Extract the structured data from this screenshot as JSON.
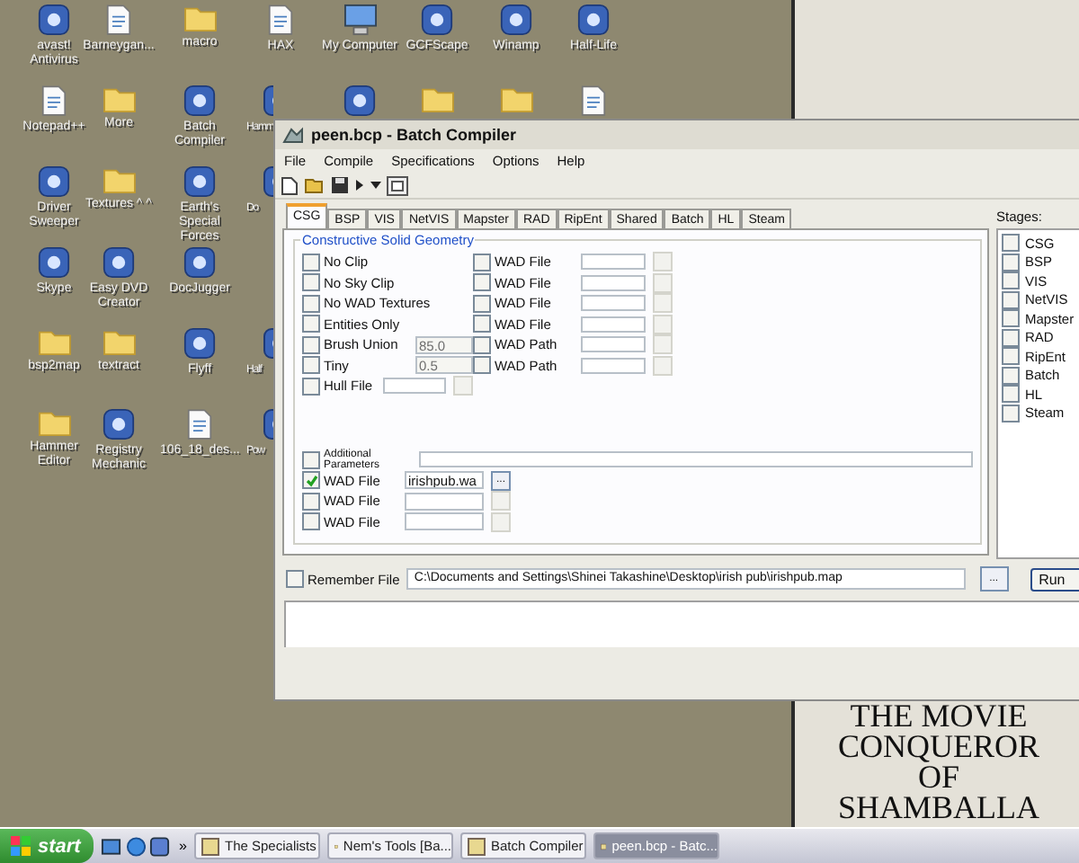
{
  "desktop": {
    "icon_rows": [
      [
        {
          "label": "avast! Antivirus",
          "kind": "app"
        },
        {
          "label": "Barneygan...",
          "kind": "document"
        },
        {
          "label": "macro",
          "kind": "folder"
        },
        {
          "label": "HAX",
          "kind": "document"
        },
        {
          "label": "My Computer",
          "kind": "computer"
        },
        {
          "label": "GCFScape",
          "kind": "app"
        },
        {
          "label": "Winamp",
          "kind": "app"
        },
        {
          "label": "Half-Life",
          "kind": "app"
        }
      ],
      [
        {
          "label": "Notepad++",
          "kind": "document"
        },
        {
          "label": "More",
          "kind": "folder"
        },
        {
          "label": "Batch Compiler",
          "kind": "app"
        },
        {
          "label": "Hamm",
          "kind": "app"
        },
        {
          "kind": "app"
        },
        {
          "kind": "folder"
        },
        {
          "kind": "folder"
        },
        {
          "kind": "document"
        }
      ],
      [
        {
          "label": "Driver Sweeper",
          "kind": "app"
        },
        {
          "label": "Textures ^ ^",
          "kind": "folder"
        },
        {
          "label": "Earth's Special Forces",
          "kind": "app"
        },
        {
          "label": "Do",
          "kind": "app"
        }
      ],
      [
        {
          "label": "Skype",
          "kind": "app"
        },
        {
          "label": "Easy DVD Creator",
          "kind": "app"
        },
        {
          "label": "DocJugger",
          "kind": "app"
        }
      ],
      [
        {
          "label": "bsp2map",
          "kind": "folder"
        },
        {
          "label": "textract",
          "kind": "folder"
        },
        {
          "label": "Flyff",
          "kind": "app"
        },
        {
          "label": "Half",
          "kind": "app"
        }
      ],
      [
        {
          "label": "Hammer Editor",
          "kind": "folder"
        },
        {
          "label": "Registry Mechanic",
          "kind": "app"
        },
        {
          "label": "106_18_des...",
          "kind": "document"
        },
        {
          "label": "Pow",
          "kind": "app"
        }
      ]
    ],
    "wallpaper_caption": [
      "THE MOVIE",
      "CONQUEROR",
      "OF",
      "SHAMBALLA"
    ]
  },
  "window": {
    "title": "peen.bcp - Batch Compiler",
    "menu": [
      "File",
      "Compile",
      "Specifications",
      "Options",
      "Help"
    ],
    "tabs": [
      {
        "label": "CSG",
        "selected": true
      },
      {
        "label": "BSP",
        "selected": false
      },
      {
        "label": "VIS",
        "selected": false
      },
      {
        "label": "NetVIS",
        "selected": false
      },
      {
        "label": "Mapster",
        "selected": false
      },
      {
        "label": "RAD",
        "selected": false
      },
      {
        "label": "RipEnt",
        "selected": false
      },
      {
        "label": "Shared",
        "selected": false
      },
      {
        "label": "Batch",
        "selected": false
      },
      {
        "label": "HL",
        "selected": false
      },
      {
        "label": "Steam",
        "selected": false
      }
    ],
    "csg": {
      "title": "Constructive Solid Geometry",
      "options": [
        {
          "label": "No Clip",
          "checked": false,
          "kind": "plain"
        },
        {
          "label": "No Sky Clip",
          "checked": false,
          "kind": "plain"
        },
        {
          "label": "No WAD Textures",
          "checked": false,
          "kind": "plain"
        },
        {
          "label": "Entities Only",
          "checked": false,
          "kind": "plain"
        },
        {
          "label": "Brush Union",
          "checked": false,
          "kind": "value",
          "value": "85.0"
        },
        {
          "label": "Tiny",
          "checked": false,
          "kind": "value",
          "value": "0.5"
        },
        {
          "label": "Hull File",
          "checked": false,
          "kind": "file"
        }
      ],
      "wad_options": [
        {
          "label": "WAD File",
          "checked": false
        },
        {
          "label": "WAD File",
          "checked": false
        },
        {
          "label": "WAD File",
          "checked": false
        },
        {
          "label": "WAD File",
          "checked": false
        },
        {
          "label": "WAD Path",
          "checked": false
        },
        {
          "label": "WAD Path",
          "checked": false
        }
      ],
      "additional_parameters": {
        "label": "Additional Parameters",
        "checked": false
      },
      "wad_files": [
        {
          "label": "WAD File",
          "checked": true,
          "value": "irishpub.wa",
          "button": "..."
        },
        {
          "label": "WAD File",
          "checked": false
        },
        {
          "label": "WAD File",
          "checked": false
        }
      ]
    },
    "remember_file": {
      "label": "Remember File",
      "checked": false
    },
    "map_path": "C:\\Documents and Settings\\Shinei Takashine\\Desktop\\irish pub\\irishpub.map",
    "browse_button": "...",
    "run_button": "Run",
    "stages": {
      "label": "Stages:",
      "items": [
        {
          "label": "CSG",
          "checked": false
        },
        {
          "label": "BSP",
          "checked": false
        },
        {
          "label": "VIS",
          "checked": false
        },
        {
          "label": "NetVIS",
          "checked": false
        },
        {
          "label": "Mapster",
          "checked": false
        },
        {
          "label": "RAD",
          "checked": false
        },
        {
          "label": "RipEnt",
          "checked": false
        },
        {
          "label": "Batch",
          "checked": false
        },
        {
          "label": "HL",
          "checked": false
        },
        {
          "label": "Steam",
          "checked": false
        }
      ]
    }
  },
  "taskbar": {
    "start": "start",
    "quick_launch_more": "»",
    "tasks": [
      {
        "label": "The Specialists",
        "selected": false
      },
      {
        "label": "Nem's Tools [Ba...",
        "selected": false
      },
      {
        "label": "Batch Compiler",
        "selected": false
      },
      {
        "label": "peen.bcp - Batc...",
        "selected": true
      }
    ]
  }
}
